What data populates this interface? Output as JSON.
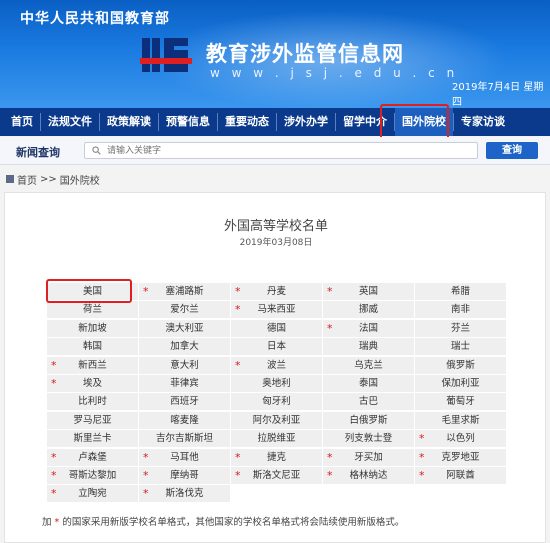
{
  "header": {
    "ministry": "中华人民共和国教育部",
    "site_title": "教育涉外监管信息网",
    "site_url": "w w w . j s j . e d u . c n",
    "date": "2019年7月4日  星期四"
  },
  "nav": {
    "items": [
      "首页",
      "法规文件",
      "政策解读",
      "预警信息",
      "重要动态",
      "涉外办学",
      "留学中介",
      "国外院校",
      "专家访谈"
    ],
    "active_index": 7
  },
  "search": {
    "label": "新闻查询",
    "placeholder": "请输入关键字",
    "button": "查询"
  },
  "breadcrumb": {
    "home": "首页",
    "separator": ">>",
    "current": "国外院校"
  },
  "content": {
    "title": "外国高等学校名单",
    "date": "2019年03月08日",
    "countries": [
      [
        {
          "name": "美国",
          "star": false
        },
        {
          "name": "塞浦路斯",
          "star": true
        },
        {
          "name": "丹麦",
          "star": true
        },
        {
          "name": "英国",
          "star": true
        },
        {
          "name": "希腊",
          "star": false
        }
      ],
      [
        {
          "name": "荷兰",
          "star": false
        },
        {
          "name": "爱尔兰",
          "star": false
        },
        {
          "name": "马来西亚",
          "star": true
        },
        {
          "name": "挪威",
          "star": false
        },
        {
          "name": "南非",
          "star": false
        }
      ],
      [
        {
          "name": "新加坡",
          "star": false
        },
        {
          "name": "澳大利亚",
          "star": false
        },
        {
          "name": "德国",
          "star": false
        },
        {
          "name": "法国",
          "star": true
        },
        {
          "name": "芬兰",
          "star": false
        }
      ],
      [
        {
          "name": "韩国",
          "star": false
        },
        {
          "name": "加拿大",
          "star": false
        },
        {
          "name": "日本",
          "star": false
        },
        {
          "name": "瑞典",
          "star": false
        },
        {
          "name": "瑞士",
          "star": false
        }
      ],
      [
        {
          "name": "新西兰",
          "star": true
        },
        {
          "name": "意大利",
          "star": false
        },
        {
          "name": "波兰",
          "star": true
        },
        {
          "name": "乌克兰",
          "star": false
        },
        {
          "name": "俄罗斯",
          "star": false
        }
      ],
      [
        {
          "name": "埃及",
          "star": true
        },
        {
          "name": "菲律宾",
          "star": false
        },
        {
          "name": "奥地利",
          "star": false
        },
        {
          "name": "泰国",
          "star": false
        },
        {
          "name": "保加利亚",
          "star": false
        }
      ],
      [
        {
          "name": "比利时",
          "star": false
        },
        {
          "name": "西班牙",
          "star": false
        },
        {
          "name": "匈牙利",
          "star": false
        },
        {
          "name": "古巴",
          "star": false
        },
        {
          "name": "葡萄牙",
          "star": false
        }
      ],
      [
        {
          "name": "罗马尼亚",
          "star": false
        },
        {
          "name": "喀麦隆",
          "star": false
        },
        {
          "name": "阿尔及利亚",
          "star": false
        },
        {
          "name": "白俄罗斯",
          "star": false
        },
        {
          "name": "毛里求斯",
          "star": false
        }
      ],
      [
        {
          "name": "斯里兰卡",
          "star": false
        },
        {
          "name": "吉尔吉斯斯坦",
          "star": false
        },
        {
          "name": "拉脱维亚",
          "star": false
        },
        {
          "name": "列支敦士登",
          "star": false
        },
        {
          "name": "以色列",
          "star": true
        }
      ],
      [
        {
          "name": "卢森堡",
          "star": true
        },
        {
          "name": "马耳他",
          "star": true
        },
        {
          "name": "捷克",
          "star": true
        },
        {
          "name": "牙买加",
          "star": true
        },
        {
          "name": "克罗地亚",
          "star": true
        }
      ],
      [
        {
          "name": "哥斯达黎加",
          "star": true
        },
        {
          "name": "摩纳哥",
          "star": true
        },
        {
          "name": "斯洛文尼亚",
          "star": true
        },
        {
          "name": "格林纳达",
          "star": true
        },
        {
          "name": "阿联酋",
          "star": true
        }
      ],
      [
        {
          "name": "立陶宛",
          "star": true
        },
        {
          "name": "斯洛伐克",
          "star": true
        },
        {
          "name": "",
          "star": false
        },
        {
          "name": "",
          "star": false
        },
        {
          "name": "",
          "star": false
        }
      ]
    ],
    "note_prefix": "加",
    "note_star": "*",
    "note_text": "的国家采用新版学校名单格式，其他国家的学校名单格式将会陆续使用新版格式。"
  },
  "colors": {
    "nav_bg": "#0b3a8c",
    "accent_red": "#e02020",
    "star_red": "#d01c1c",
    "button_blue": "#1e63c7"
  }
}
